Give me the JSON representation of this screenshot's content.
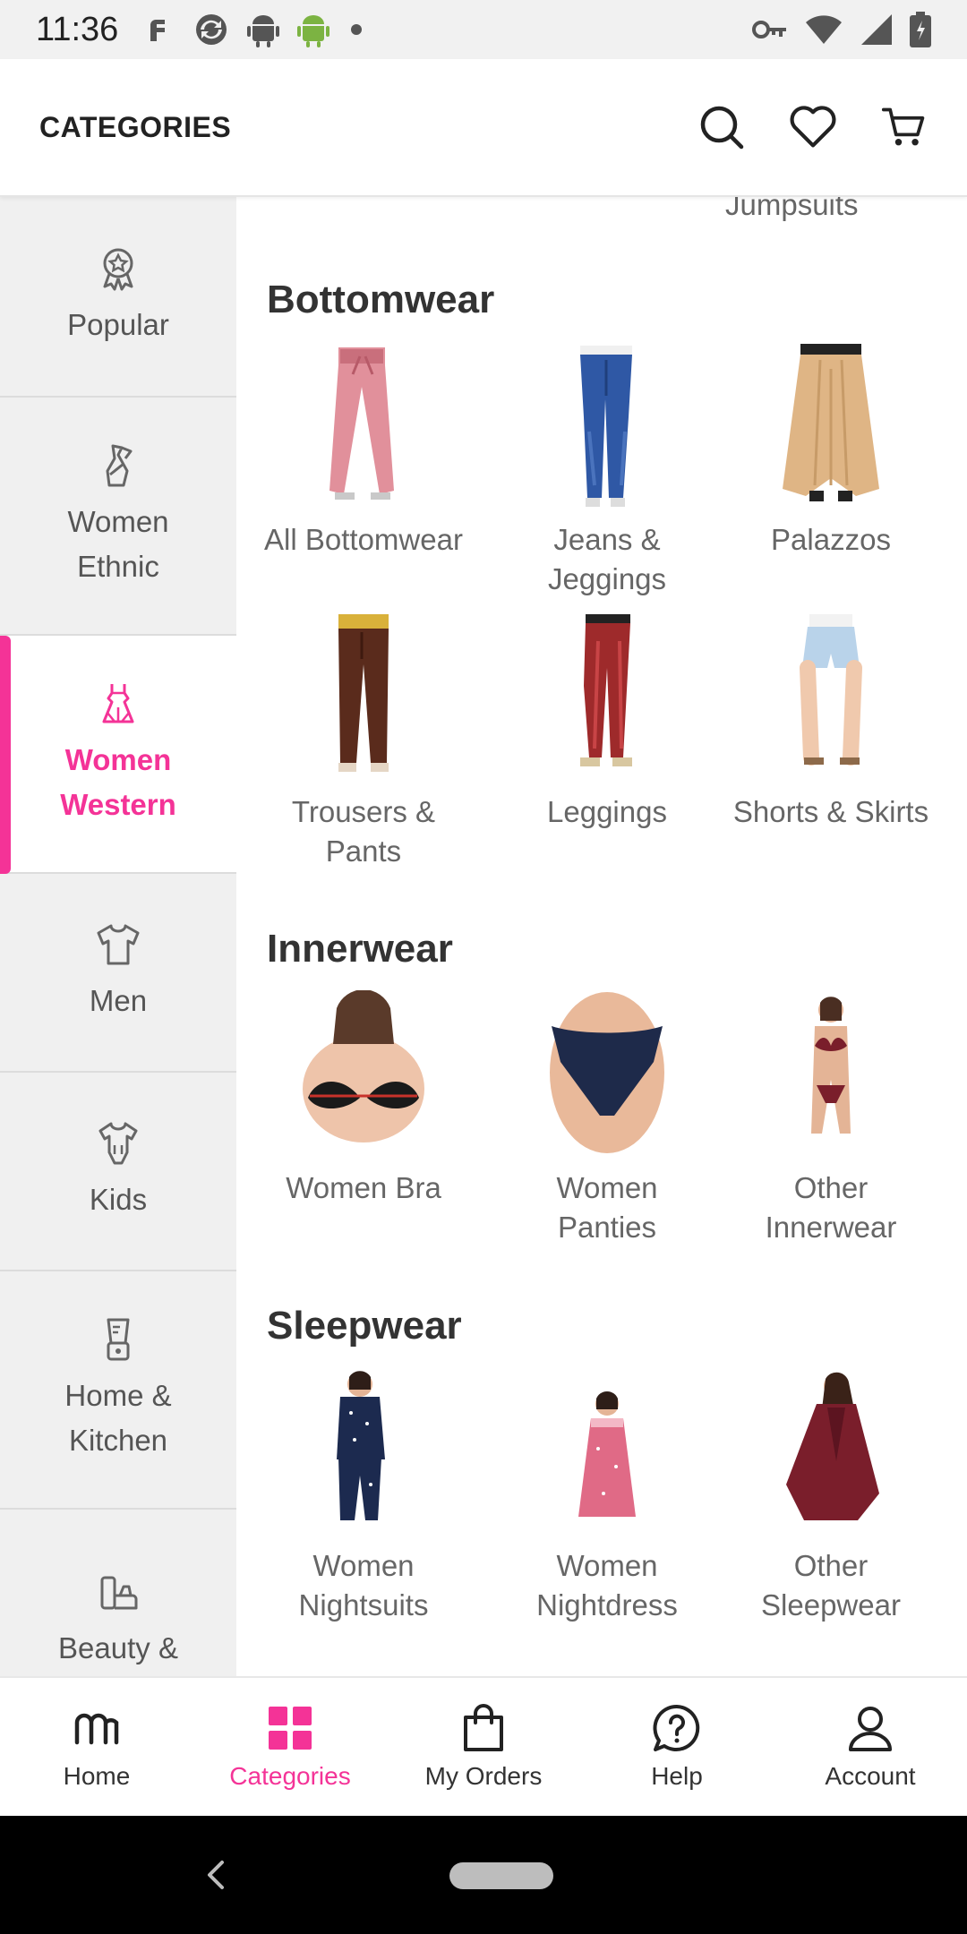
{
  "status_bar": {
    "time": "11:36",
    "icons": [
      "notification-app-icon",
      "sync-icon",
      "android-icon",
      "android-green-icon",
      "dot-icon"
    ],
    "right_icons": [
      "vpn-key-icon",
      "wifi-icon",
      "signal-icon",
      "battery-icon"
    ]
  },
  "header": {
    "title": "CATEGORIES",
    "actions": [
      "search-icon",
      "wishlist-heart-icon",
      "cart-icon"
    ]
  },
  "sidebar": {
    "items": [
      {
        "label": "Popular",
        "icon": "badge-star-icon"
      },
      {
        "label": "Women\nEthnic",
        "icon": "saree-icon"
      },
      {
        "label": "Women\nWestern",
        "icon": "dress-icon",
        "active": true
      },
      {
        "label": "Men",
        "icon": "tshirt-icon"
      },
      {
        "label": "Kids",
        "icon": "onesie-icon"
      },
      {
        "label": "Home &\nKitchen",
        "icon": "blender-icon"
      },
      {
        "label": "Beauty &\nHealth",
        "icon": "cosmetics-icon"
      }
    ]
  },
  "main": {
    "partial_top_label": "Jumpsuits",
    "sections": [
      {
        "title": "Bottomwear",
        "items": [
          {
            "label": "All Bottomwear"
          },
          {
            "label": "Jeans &\nJeggings"
          },
          {
            "label": "Palazzos"
          },
          {
            "label": "Trousers &\nPants"
          },
          {
            "label": "Leggings"
          },
          {
            "label": "Shorts & Skirts"
          }
        ]
      },
      {
        "title": "Innerwear",
        "items": [
          {
            "label": "Women Bra"
          },
          {
            "label": "Women\nPanties"
          },
          {
            "label": "Other\nInnerwear"
          }
        ]
      },
      {
        "title": "Sleepwear",
        "items": [
          {
            "label": "Women\nNightsuits"
          },
          {
            "label": "Women\nNightdress"
          },
          {
            "label": "Other\nSleepwear"
          }
        ]
      }
    ]
  },
  "bottom_nav": {
    "items": [
      {
        "label": "Home",
        "icon": "meesho-home-icon"
      },
      {
        "label": "Categories",
        "icon": "grid-icon",
        "active": true
      },
      {
        "label": "My Orders",
        "icon": "shopping-bag-icon"
      },
      {
        "label": "Help",
        "icon": "help-bubble-icon"
      },
      {
        "label": "Account",
        "icon": "account-icon"
      }
    ]
  },
  "colors": {
    "accent": "#f43397",
    "sidebar_bg": "#f0f0f0",
    "text": "#333333"
  }
}
